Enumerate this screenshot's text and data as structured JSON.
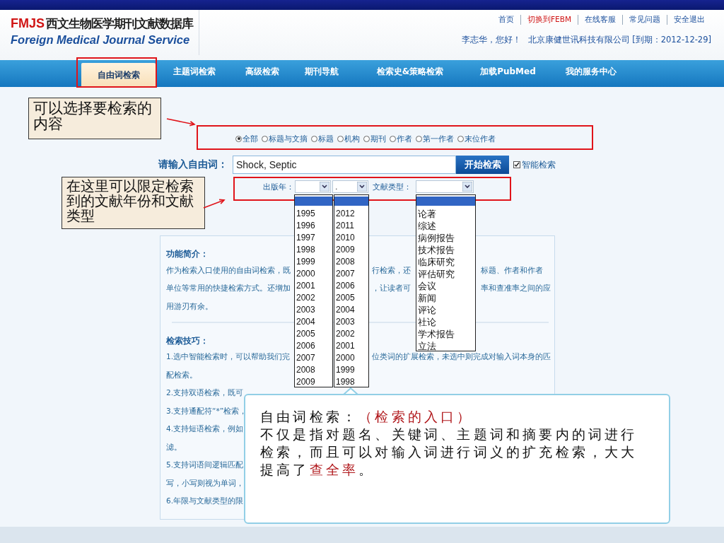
{
  "header": {
    "logo_abbr": "FMJS",
    "logo_title": "西文生物医学期刊文献数据库",
    "logo_subtitle": "Foreign Medical Journal Service",
    "links": [
      {
        "label": "首页",
        "highlight": false
      },
      {
        "label": "切换到FEBM",
        "highlight": true
      },
      {
        "label": "在线客服",
        "highlight": false
      },
      {
        "label": "常见问题",
        "highlight": false
      },
      {
        "label": "安全退出",
        "highlight": false
      }
    ],
    "welcome": "李志华，您好！",
    "company": "北京康健世讯科技有限公司 [到期：2012-12-29]"
  },
  "nav": [
    {
      "label": "自由词检索",
      "selected": true
    },
    {
      "label": "主题词检索",
      "selected": false
    },
    {
      "label": "高级检索",
      "selected": false
    },
    {
      "label": "期刊导航",
      "selected": false
    },
    {
      "label": "检索史&策略检索",
      "selected": false
    },
    {
      "label": "加载PubMed",
      "selected": false
    },
    {
      "label": "我的服务中心",
      "selected": false
    }
  ],
  "scope_options": [
    {
      "label": "全部",
      "selected": true
    },
    {
      "label": "标题与文摘",
      "selected": false
    },
    {
      "label": "标题",
      "selected": false
    },
    {
      "label": "机构",
      "selected": false
    },
    {
      "label": "期刊",
      "selected": false
    },
    {
      "label": "作者",
      "selected": false
    },
    {
      "label": "第一作者",
      "selected": false
    },
    {
      "label": "末位作者",
      "selected": false
    }
  ],
  "search": {
    "label": "请输入自由词：",
    "value": "Shock, Septic",
    "button": "开始检索",
    "smart_label": "智能检索",
    "smart_checked": true
  },
  "filters": {
    "year_label": "出版年：",
    "type_label": "文献类型：",
    "selects": [
      {
        "kind": "year"
      },
      {
        "kind": "year",
        "value": "."
      },
      {
        "kind": "type"
      }
    ]
  },
  "dropdowns": [
    {
      "blank_selected": true,
      "options": [
        "1995",
        "1996",
        "1997",
        "1998",
        "1999",
        "2000",
        "2001",
        "2002",
        "2003",
        "2004",
        "2005",
        "2006",
        "2007",
        "2008",
        "2009"
      ]
    },
    {
      "blank_selected": true,
      "options": [
        "2012",
        "2011",
        "2010",
        "2009",
        "2008",
        "2007",
        "2006",
        "2005",
        "2004",
        "2003",
        "2002",
        "2001",
        "2000",
        "1999",
        "1998"
      ]
    },
    {
      "blank_selected": true,
      "options": [
        "论著",
        "综述",
        "病例报告",
        "技术报告",
        "临床研究",
        "评估研究",
        "会议",
        "新闻",
        "评论",
        "社论",
        "学术报告",
        "立法"
      ]
    }
  ],
  "info": {
    "intro_title": "功能简介：",
    "intro_lines": [
      {
        "column_1": "作为检索入口使用的自由词检索，既",
        "column_2": "行检索，还",
        "column_3": "标题、作者和作者"
      },
      {
        "column_1": "单位等常用的快捷检索方式。还增加",
        "column_2": "，让读者可",
        "column_3": "率和查准率之间的应"
      },
      {
        "column_1": "用游刃有余。"
      }
    ],
    "tips_title": "检索技巧：",
    "tip_lines": [
      {
        "column_1": "1.选中智能检索时，可以帮助我们完",
        "column_2": "位类词的扩展检索，未选中则完成对输入词本身的匹"
      },
      {
        "column_1": "配检索。"
      },
      {
        "column_1": "2.支持双语检索，既可"
      },
      {
        "column_1": "3.支持通配符“*”检索，"
      },
      {
        "column_1": "4.支持短语检索，例如"
      },
      {
        "column_1": "滤。"
      },
      {
        "column_1": "5.支持词语间逻辑匹配"
      },
      {
        "column_1": "写，小写则视为单词，"
      },
      {
        "column_1": "6.年限与文献类型的限"
      }
    ]
  },
  "annotations": [
    {
      "text": "可以选择要检索的内容"
    },
    {
      "text": "在这里可以限定检索到的文献年份和文献类型"
    }
  ],
  "callout": {
    "title": "自由词检索：",
    "title_note": "（检索的入口）",
    "body": "不仅是指对题名、关键词、主题词和摘要内的词进行检索，而且可以对输入词进行词义的扩充检索，大大提高了",
    "body_highlight": "查全率",
    "body_end": "。"
  }
}
